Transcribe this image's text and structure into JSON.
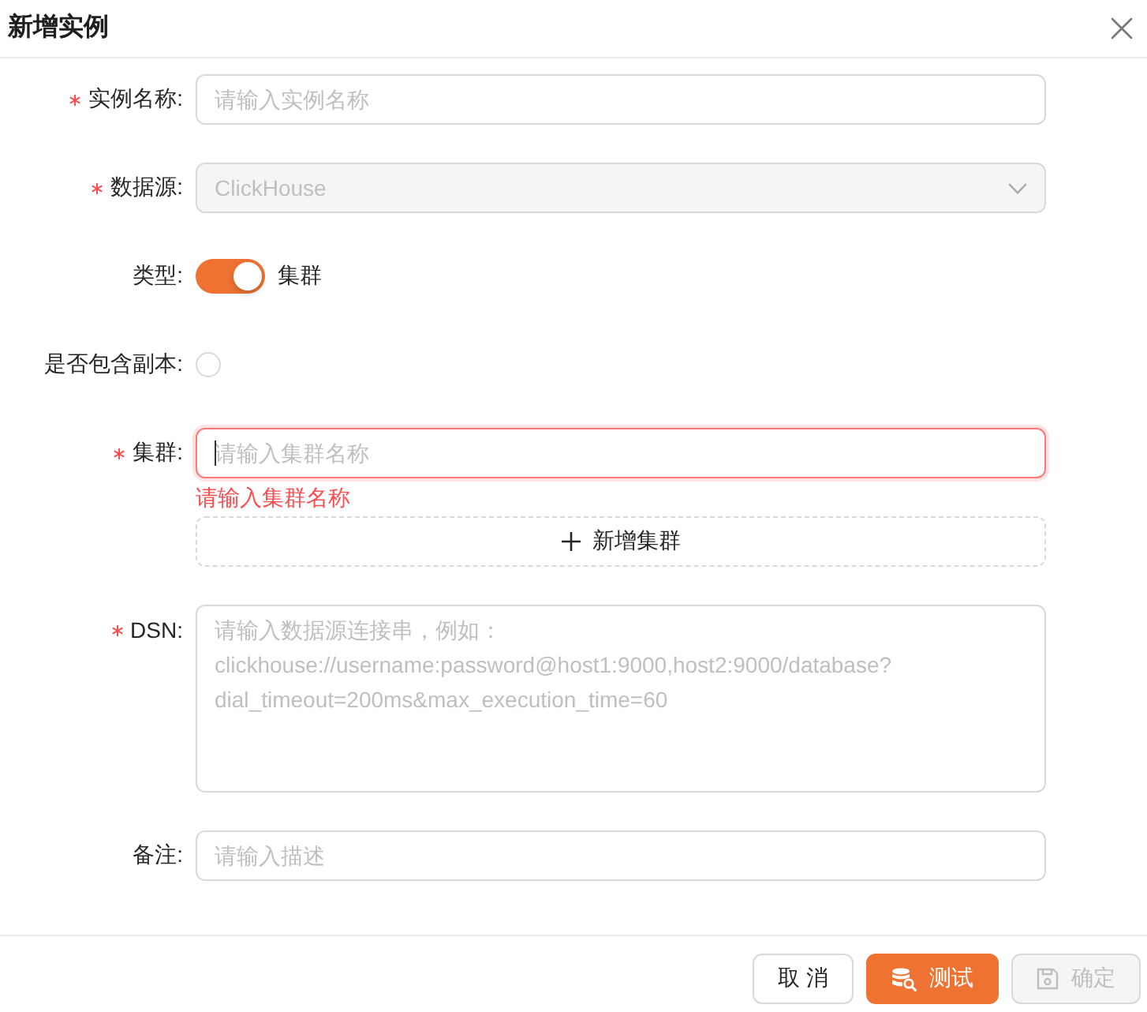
{
  "dialog": {
    "title": "新增实例"
  },
  "form": {
    "fields": [
      {
        "kind": "input",
        "label": "实例名称:",
        "required": true,
        "placeholder": "请输入实例名称",
        "focused": false
      },
      {
        "kind": "select",
        "label": "数据源:",
        "required": true,
        "value": "ClickHouse",
        "disabled": true
      },
      {
        "kind": "switch",
        "label": "类型:",
        "required": false,
        "on": true,
        "text": "集群"
      },
      {
        "kind": "radio",
        "label": "是否包含副本:",
        "required": false,
        "checked": false
      },
      {
        "kind": "input",
        "label": "集群:",
        "required": true,
        "placeholder": "请输入集群名称",
        "focused": true,
        "error": "请输入集群名称",
        "add_button": "新增集群"
      },
      {
        "kind": "textarea",
        "label": "DSN:",
        "required": true,
        "placeholder": "请输入数据源连接串，例如：\nclickhouse://username:password@host1:9000,host2:9000/database?\ndial_timeout=200ms&max_execution_time=60"
      },
      {
        "kind": "input",
        "label": "备注:",
        "required": false,
        "placeholder": "请输入描述",
        "focused": false
      }
    ]
  },
  "footer": {
    "buttons": [
      {
        "kind": "cancel",
        "label": "取 消",
        "disabled": false
      },
      {
        "kind": "test",
        "label": "测试",
        "disabled": false
      },
      {
        "kind": "submit",
        "label": "确定",
        "disabled": true
      }
    ]
  }
}
